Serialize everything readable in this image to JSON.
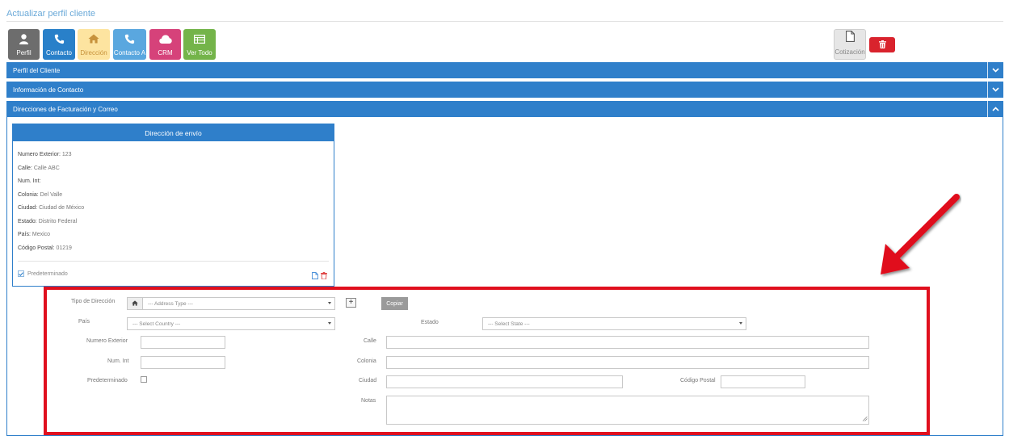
{
  "page": {
    "title": "Actualizar perfil cliente"
  },
  "toolbar": {
    "perfil": "Perfil",
    "contacto": "Contacto",
    "direccion": "Dirección",
    "contacto_a": "Contacto A",
    "crm": "CRM",
    "ver_todo": "Ver Todo",
    "cotizacion": "Cotización"
  },
  "sections": {
    "perfil": "Perfil del Cliente",
    "contacto": "Información de Contacto",
    "direcciones": "Direcciones de Facturación y Correo"
  },
  "address_card": {
    "title": "Dirección de envío",
    "fields": [
      {
        "key": "Numero Exterior:",
        "value": "123"
      },
      {
        "key": "Calle:",
        "value": "Calle ABC"
      },
      {
        "key": "Num. Int:",
        "value": ""
      },
      {
        "key": "Colonia:",
        "value": "Del Valle"
      },
      {
        "key": "Ciudad:",
        "value": "Ciudad de México"
      },
      {
        "key": "Estado:",
        "value": "Distrito Federal"
      },
      {
        "key": "País:",
        "value": "Mexico"
      },
      {
        "key": "Código Postal:",
        "value": "01219"
      }
    ],
    "default_label": "Predeterminado"
  },
  "form": {
    "tipo_label": "Tipo de Dirección",
    "tipo_placeholder": "--- Address Type ---",
    "copiar": "Copiar",
    "pais_label": "País",
    "pais_placeholder": "--- Select Country ---",
    "estado_label": "Estado",
    "estado_placeholder": "--- Select State ---",
    "num_ext_label": "Numero Exterior",
    "num_int_label": "Num. Int",
    "predeterminado_label": "Predeterminado",
    "calle_label": "Calle",
    "colonia_label": "Colonia",
    "ciudad_label": "Ciudad",
    "cp_label": "Código Postal",
    "notas_label": "Notas"
  },
  "colors": {
    "primary": "#2f7fca",
    "highlight": "#e0101e",
    "danger": "#d9232d"
  }
}
